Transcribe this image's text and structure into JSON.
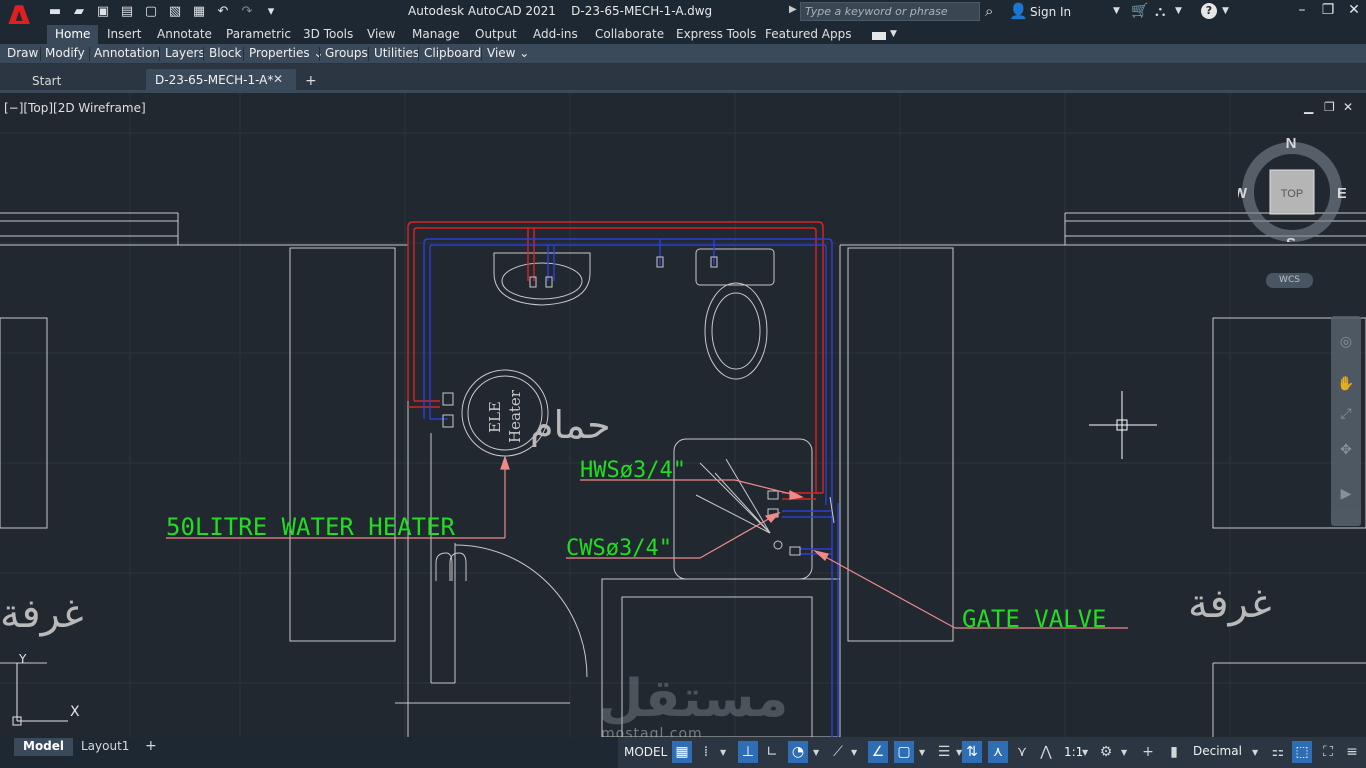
{
  "app": {
    "logo": "A",
    "title": "Autodesk AutoCAD 2021    D-23-65-MECH-1-A.dwg"
  },
  "quick_access": [
    "new-icon",
    "open-icon",
    "save-icon",
    "save-as-icon",
    "export-icon",
    "import-icon",
    "print-icon",
    "undo-icon",
    "redo-icon",
    "customize-icon"
  ],
  "search": {
    "placeholder": "Type a keyword or phrase"
  },
  "account": {
    "sign_in": "Sign In"
  },
  "ribbon_tabs": [
    "Home",
    "Insert",
    "Annotate",
    "Parametric",
    "3D Tools",
    "View",
    "Manage",
    "Output",
    "Add-ins",
    "Collaborate",
    "Express Tools",
    "Featured Apps"
  ],
  "panels": [
    "Draw",
    "Modify",
    "Annotation",
    "Layers",
    "Block",
    "Properties ⌄",
    "Groups",
    "Utilities",
    "Clipboard",
    "View ⌄"
  ],
  "file_tabs": {
    "start": "Start",
    "document": "D-23-65-MECH-1-A*"
  },
  "viewport": {
    "label": "[−][Top][2D Wireframe]"
  },
  "viewcube": {
    "top": "TOP",
    "north": "N",
    "south": "S",
    "east": "E",
    "west": "W",
    "wcs": "WCS"
  },
  "ucs": {
    "x": "X",
    "y": "Y"
  },
  "drawing_text": {
    "heater_label": "50LITRE WATER HEATER",
    "hws_label": "HWSø3/4\"",
    "cws_label": "CWSø3/4\"",
    "valve_label": "GATE VALVE",
    "heater_name_1": "ELE",
    "heater_name_2": "Heater",
    "bathroom": "حمام",
    "room_left": "غرفة",
    "room_right": "غرفة"
  },
  "colors": {
    "background": "#212830",
    "hot_pipe": "#e02a2a",
    "cold_pipe": "#2a3fd0",
    "annotation": "#22dd22",
    "leader": "#ef8a8a",
    "walls": "#cfcfcf"
  },
  "layout_tabs": [
    "Model",
    "Layout1"
  ],
  "status": {
    "model": "MODEL",
    "scale": "1:1",
    "units": "Decimal"
  },
  "watermark": {
    "arabic": "مستقل",
    "latin": "mostaql.com"
  }
}
